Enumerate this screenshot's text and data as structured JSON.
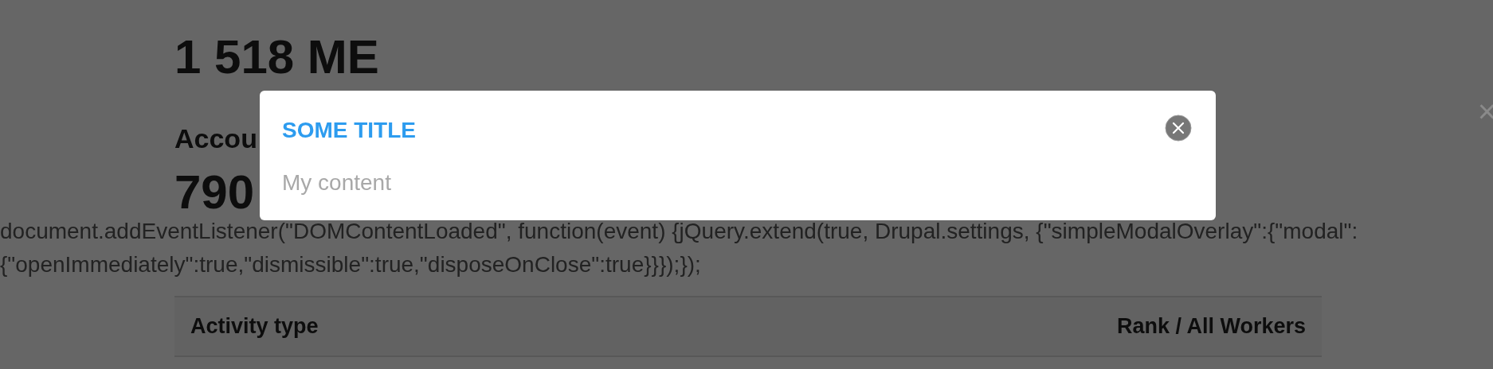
{
  "page": {
    "heading": "1 518 ME",
    "subheading": "Accou",
    "amount": "790",
    "script_text": "document.addEventListener(\"DOMContentLoaded\", function(event) {jQuery.extend(true, Drupal.settings, {\"simpleModalOverlay\":{\"modal\":{\"openImmediately\":true,\"dismissible\":true,\"disposeOnClose\":true}}});});",
    "table": {
      "columns": [
        "Activity type",
        "Rank / All Workers"
      ]
    }
  },
  "overlay_close": "×",
  "modal": {
    "title": "SOME TITLE",
    "content": "My content"
  }
}
